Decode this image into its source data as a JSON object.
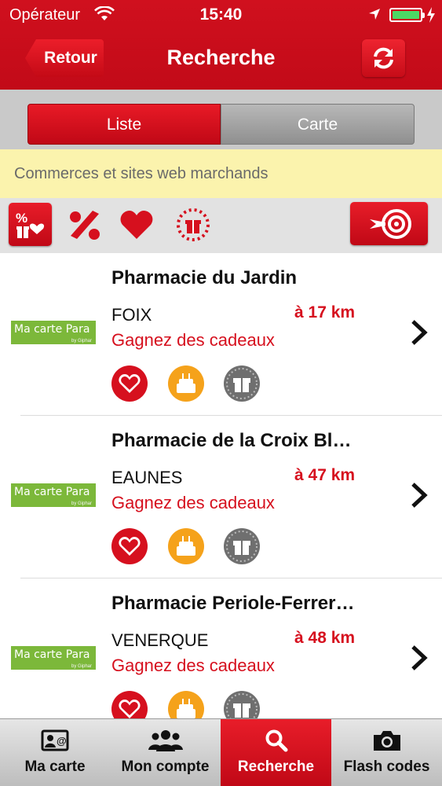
{
  "status_bar": {
    "carrier": "Opérateur",
    "time": "15:40"
  },
  "nav": {
    "back_label": "Retour",
    "title": "Recherche"
  },
  "segments": {
    "list_label": "Liste",
    "map_label": "Carte",
    "selected": "Liste"
  },
  "info_banner": "Commerces et sites web marchands",
  "filters": [
    "all-offers-icon",
    "discount-icon",
    "heart-icon",
    "gift-countdown-icon",
    "target-icon"
  ],
  "results": [
    {
      "name": "Pharmacie du Jardin",
      "city": "FOIX",
      "distance": "à 17 km",
      "promo": "Gagnez des cadeaux",
      "logo_text": "Ma carte Para",
      "logo_sub": "by Giphar"
    },
    {
      "name": "Pharmacie de la Croix Bl…",
      "city": "EAUNES",
      "distance": "à 47 km",
      "promo": "Gagnez des cadeaux",
      "logo_text": "Ma carte Para",
      "logo_sub": "by Giphar"
    },
    {
      "name": "Pharmacie Periole-Ferrer…",
      "city": "VENERQUE",
      "distance": "à 48 km",
      "promo": "Gagnez des cadeaux",
      "logo_text": "Ma carte Para",
      "logo_sub": "by Giphar"
    }
  ],
  "tabbar": {
    "tabs": [
      {
        "label": "Ma carte",
        "icon": "id-card-icon"
      },
      {
        "label": "Mon compte",
        "icon": "users-icon"
      },
      {
        "label": "Recherche",
        "icon": "search-icon"
      },
      {
        "label": "Flash codes",
        "icon": "camera-icon"
      }
    ],
    "active": "Recherche"
  },
  "colors": {
    "brand_red": "#d0101e",
    "banner_yellow": "#fbf3ad",
    "badge_orange": "#f5a21b",
    "badge_gray": "#7a7a7a",
    "logo_green": "#7cb83a"
  }
}
